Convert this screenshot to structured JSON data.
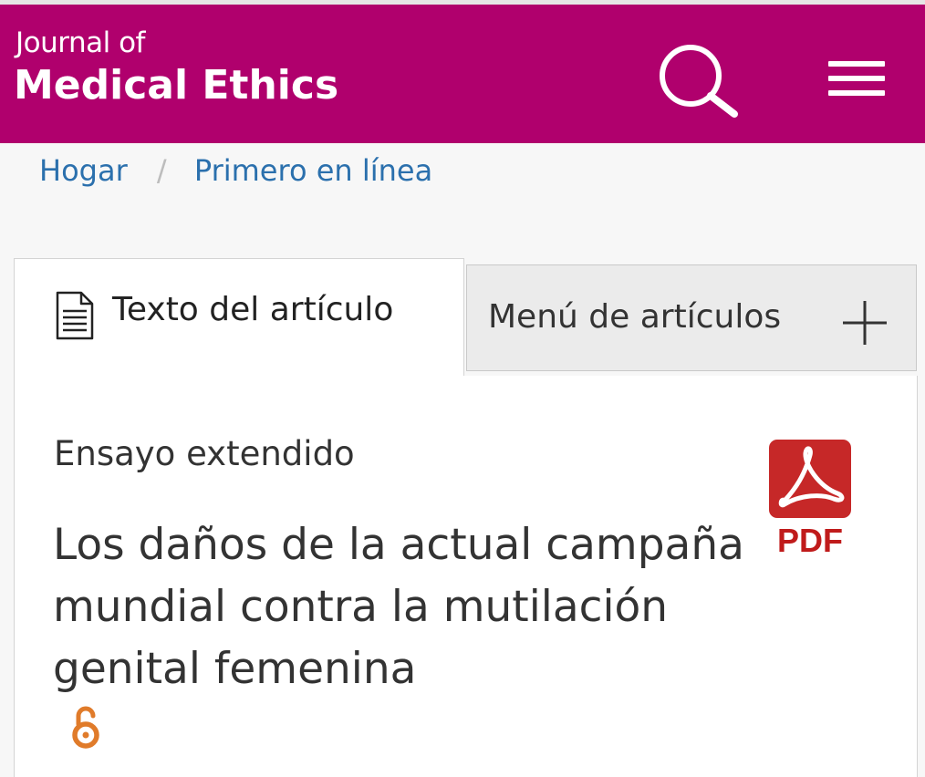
{
  "header": {
    "journal_prefix": "Journal of",
    "journal_name": "Medical Ethics",
    "brand_color": "#b0006d",
    "search_icon": "search-icon",
    "menu_icon": "hamburger-menu-icon"
  },
  "breadcrumb": {
    "items": [
      {
        "label": "Hogar"
      },
      {
        "label": "Primero en línea"
      }
    ],
    "separator": "/"
  },
  "tabs": [
    {
      "label": "Texto del artículo",
      "icon": "document-icon",
      "active": true
    },
    {
      "label": "Menú de artículos",
      "icon": "plus-icon",
      "active": false
    }
  ],
  "article": {
    "type": "Ensayo extendido",
    "title": "Los daños de la actual campaña mundial contra la mutilación genital femenina",
    "open_access_icon": "open-access-icon",
    "pdf_label": "PDF",
    "pdf_color": "#c01b1b",
    "open_access_color": "#e07b2a"
  }
}
